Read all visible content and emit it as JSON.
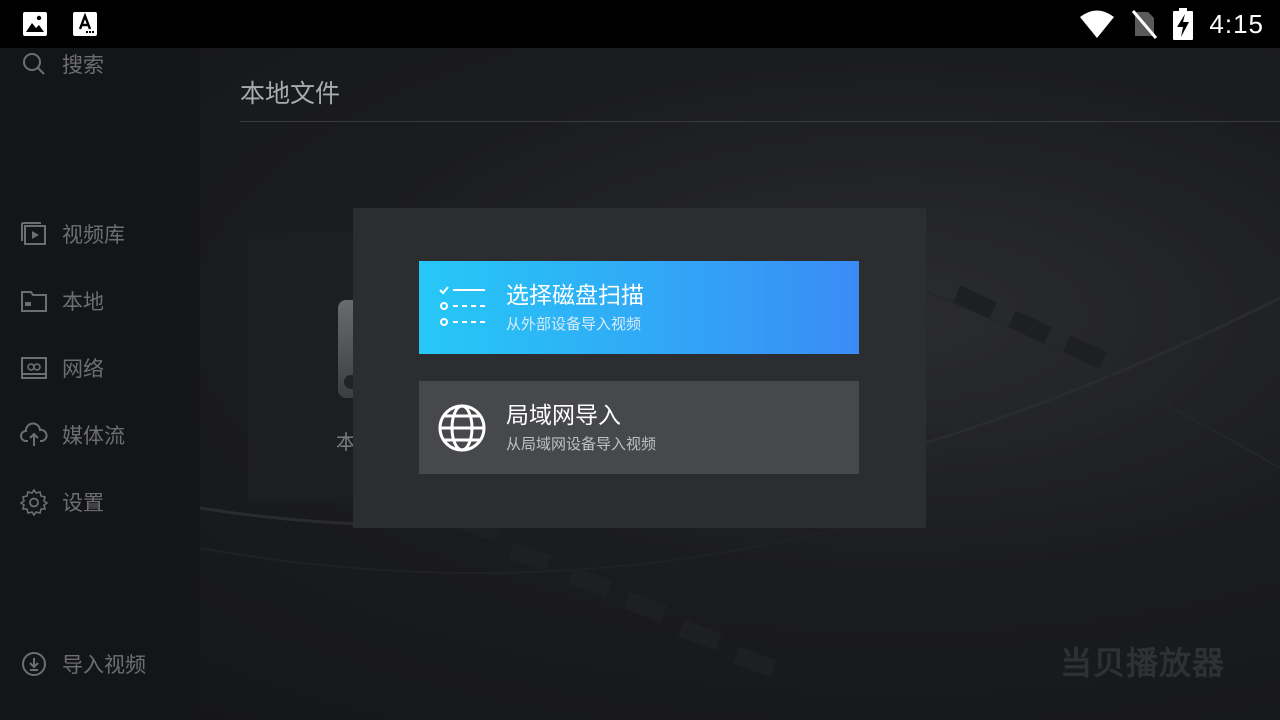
{
  "status_bar": {
    "time": "4:15",
    "left_icons": [
      "gallery-icon",
      "font-icon"
    ],
    "right_icons": [
      "wifi-icon",
      "no-sim-icon",
      "battery-charging-icon"
    ]
  },
  "sidebar": {
    "search_label": "搜索",
    "items": [
      {
        "label": "视频库",
        "icon": "video-library-icon"
      },
      {
        "label": "本地",
        "icon": "folder-icon"
      },
      {
        "label": "网络",
        "icon": "network-drive-icon"
      },
      {
        "label": "媒体流",
        "icon": "cloud-upload-icon"
      },
      {
        "label": "设置",
        "icon": "gear-icon"
      }
    ],
    "import_label": "导入视频"
  },
  "main": {
    "title": "本地文件",
    "card_label": "本"
  },
  "dialog": {
    "options": [
      {
        "title": "选择磁盘扫描",
        "subtitle": "从外部设备导入视频",
        "icon": "checklist-icon"
      },
      {
        "title": "局域网导入",
        "subtitle": "从局域网设备导入视频",
        "icon": "globe-icon"
      }
    ]
  },
  "watermark": "当贝播放器",
  "colors": {
    "primary_gradient_start": "#26c8f7",
    "primary_gradient_end": "#3a8cf5",
    "dialog_bg": "#2c2d31",
    "secondary_option_bg": "#47484c"
  }
}
